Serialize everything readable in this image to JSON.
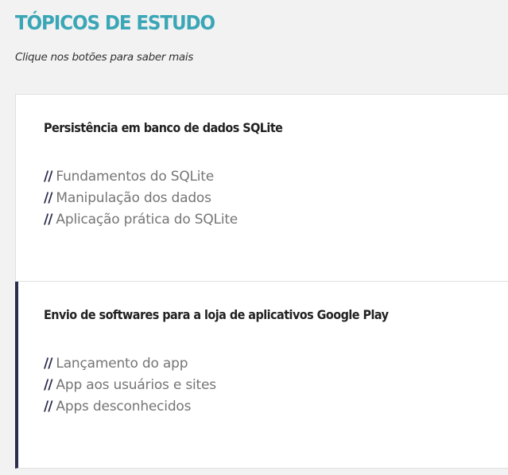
{
  "page": {
    "title": "TÓPICOS DE ESTUDO",
    "subtitle": "Clique nos botões para saber mais"
  },
  "item_prefix": "//",
  "topics": [
    {
      "title": "Persistência em banco de dados SQLite",
      "items": [
        "Fundamentos do SQLite",
        "Manipulação dos dados",
        "Aplicação prática do SQLite"
      ]
    },
    {
      "title": "Envio de softwares para a loja de aplicativos Google Play",
      "items": [
        "Lançamento do app",
        "App aos usuários e sites",
        "Apps desconhecidos"
      ]
    }
  ],
  "colors": {
    "background": "#f2f2f2",
    "title_accent": "#3aa6b6",
    "active_marker": "#2c2e4e",
    "item_text": "#757575"
  }
}
